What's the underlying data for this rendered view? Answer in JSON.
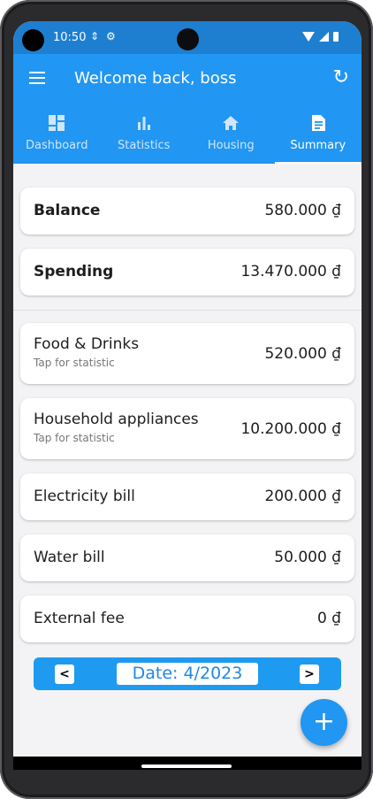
{
  "status_bar": {
    "time": "10:50"
  },
  "app_bar": {
    "title": "Welcome back, boss"
  },
  "tabs": [
    {
      "label": "Dashboard",
      "icon": "dashboard-icon"
    },
    {
      "label": "Statistics",
      "icon": "bar-chart-icon"
    },
    {
      "label": "Housing",
      "icon": "home-icon"
    },
    {
      "label": "Summary",
      "icon": "summary-icon",
      "active": true
    }
  ],
  "summary": [
    {
      "label": "Balance",
      "value": "580.000 ₫"
    },
    {
      "label": "Spending",
      "value": "13.470.000 ₫"
    }
  ],
  "categories": [
    {
      "label": "Food & Drinks",
      "sub": "Tap for statistic",
      "value": "520.000 ₫"
    },
    {
      "label": "Household appliances",
      "sub": "Tap for statistic",
      "value": "10.200.000 ₫"
    },
    {
      "label": "Electricity bill",
      "value": "200.000 ₫"
    },
    {
      "label": "Water bill",
      "value": "50.000 ₫"
    },
    {
      "label": "External fee",
      "value": "0 ₫"
    }
  ],
  "date_nav": {
    "prev": "<",
    "label": "Date: 4/2023",
    "next": ">"
  },
  "fab": {
    "label": "+"
  },
  "colors": {
    "primary": "#2196f3",
    "status_bar": "#1e7fd0",
    "date_bar": "#1e9af0"
  }
}
